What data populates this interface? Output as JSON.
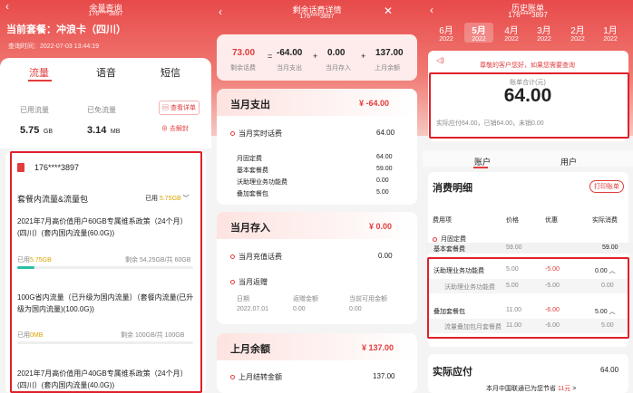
{
  "p1": {
    "title": "余量查询",
    "phone": "176****3897",
    "plan": "当前套餐：冲浪卡（四川）",
    "query_time": "查询时间：2022-07-03 13:44:19",
    "tabs": [
      "流量",
      "语音",
      "短信"
    ],
    "used_label": "已用流量",
    "used_value": "5.75",
    "used_unit": "GB",
    "free_label": "已免流量",
    "free_value": "3.14",
    "free_unit": "MB",
    "btn_detail": "查看详单",
    "btn_unblock": "去解封",
    "number": "176****3897",
    "section": "套餐内流量&流量包",
    "section_used_label": "已用",
    "section_used_value": "5.75GB",
    "items": [
      {
        "name": "2021年7月高价值用户60GB专属维系政策（24个月）(四川）(套内国内流量(60.0G))",
        "used_label": "已用",
        "used": "5.75GB",
        "remain": "剩余 54.25GB/共 60GB",
        "progress": 0.096
      },
      {
        "name": "100G省内流量（已升级为国内流量）（套餐内流量(已升级为国内流量)(100.0G))",
        "used_label": "已用",
        "used": "0MB",
        "remain": "剩余 100GB/共 100GB",
        "progress": 0
      },
      {
        "name": "2021年7月高价值用户40GB专属维系政策（24个月）(四川）(套内国内流量(40.0G))"
      }
    ]
  },
  "p2": {
    "title": "剩余话费详情",
    "phone": "176****3897",
    "formula": [
      {
        "v": "73.00",
        "l": "剩余话费"
      },
      {
        "op": "="
      },
      {
        "v": "-64.00",
        "l": "当月支出"
      },
      {
        "op": "+"
      },
      {
        "v": "0.00",
        "l": "当月存入"
      },
      {
        "op": "+"
      },
      {
        "v": "137.00",
        "l": "上月余额"
      }
    ],
    "spend_title": "当月支出",
    "spend_total": "¥ -64.00",
    "realtime_label": "当月实时话费",
    "realtime_value": "64.00",
    "fixed_label": "月固定费",
    "fixed_value": "64.00",
    "fixed_rows": [
      {
        "l": "基本套餐费",
        "v": "59.00"
      },
      {
        "l": "沃助理业务功能费",
        "v": "0.00"
      },
      {
        "l": "叠加套餐包",
        "v": "5.00"
      }
    ],
    "deposit_title": "当月存入",
    "deposit_total": "¥ 0.00",
    "recharge_label": "当月充值话费",
    "recharge_value": "0.00",
    "refund_label": "当月返赠",
    "refund_headers": [
      "日期",
      "返赠金额",
      "当前可用金额"
    ],
    "refund_row": [
      "2022.07.01",
      "0.00",
      "0.00"
    ],
    "last_title": "上月余额",
    "last_total": "¥ 137.00",
    "carry_label": "上月结转金额",
    "carry_value": "137.00"
  },
  "p3": {
    "title": "历史账单",
    "phone": "176****3897",
    "months": [
      {
        "m": "6月",
        "y": "2022"
      },
      {
        "m": "5月",
        "y": "2022"
      },
      {
        "m": "4月",
        "y": "2022"
      },
      {
        "m": "3月",
        "y": "2022"
      },
      {
        "m": "2月",
        "y": "2022"
      },
      {
        "m": "1月",
        "y": "2022"
      }
    ],
    "notice": "尊敬的客户您好，如果您需要查询",
    "total_label": "账单合计(元)",
    "total_value": "64.00",
    "summary": "实际应付64.00，已销64.00，未销0.00",
    "tabs": [
      "账户",
      "用户"
    ],
    "detail_title": "消费明细",
    "print_btn": "打印账单",
    "headers": [
      "费用项",
      "价格",
      "优惠",
      "实际消费"
    ],
    "fixed_label": "月固定费",
    "rows": [
      {
        "l": "基本套餐费",
        "p": "59.00",
        "d": "",
        "a": "59.00"
      },
      {
        "l": "沃助理业务功能费",
        "p": "5.00",
        "d": "-5.00",
        "a": "0.00 ︿"
      },
      {
        "l": "沃助理业务功能费",
        "p": "5.00",
        "d": "-5.00",
        "a": "0.00"
      },
      {
        "l": "叠加套餐包",
        "p": "11.00",
        "d": "-6.00",
        "a": "5.00 ︿"
      },
      {
        "l": "流量叠加包月套餐费",
        "p": "11.00",
        "d": "-6.00",
        "a": "5.00"
      }
    ],
    "payable_label": "实际应付",
    "payable_value": "64.00",
    "saving": "本月中国联通已为您节省",
    "saving_value": "11元",
    "saving_arrow": ">"
  }
}
